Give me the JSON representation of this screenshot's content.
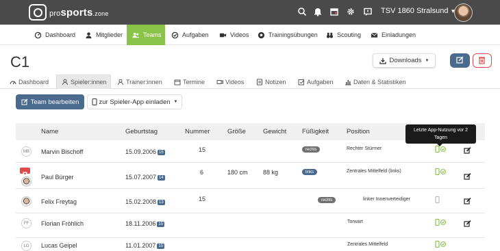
{
  "brand": {
    "logo_text_pro": "pro",
    "logo_text_sports": "sports",
    "logo_text_zone": ".zone"
  },
  "topbar": {
    "club": "TSV 1860 Stralsund"
  },
  "nav": [
    {
      "label": "Dashboard",
      "icon": "dashboard-icon"
    },
    {
      "label": "Mitglieder",
      "icon": "user-icon"
    },
    {
      "label": "Teams",
      "icon": "users-icon",
      "active": true
    },
    {
      "label": "Aufgaben",
      "icon": "check-circle-icon"
    },
    {
      "label": "Videos",
      "icon": "video-icon"
    },
    {
      "label": "Trainingsübungen",
      "icon": "soccer-ball-icon"
    },
    {
      "label": "Scouting",
      "icon": "binoculars-icon"
    },
    {
      "label": "Einladungen",
      "icon": "envelope-icon"
    }
  ],
  "page": {
    "title": "C1",
    "downloads_label": "Downloads"
  },
  "subtabs": [
    {
      "label": "Dashboard"
    },
    {
      "label": "Spieler:innen",
      "active": true
    },
    {
      "label": "Trainer:innen"
    },
    {
      "label": "Termine"
    },
    {
      "label": "Videos"
    },
    {
      "label": "Notizen"
    },
    {
      "label": "Aufgaben"
    },
    {
      "label": "Daten & Statistiken"
    }
  ],
  "actions": {
    "team_edit": "Team bearbeiten",
    "invite": "zur Spieler-App einladen"
  },
  "table": {
    "headers": {
      "name": "Name",
      "birthday": "Geburtstag",
      "number": "Nummer",
      "height": "Größe",
      "weight": "Gewicht",
      "foot": "Füßigkeit",
      "position": "Position"
    },
    "tooltip": "Letzte App-Nutzung vor 2 Tagen",
    "rows": [
      {
        "initials": "MB",
        "name": "Marvin Bischoff",
        "birthday": "15.09.2006",
        "age": "15",
        "number": "15",
        "height": "",
        "weight": "",
        "foot": "rechts",
        "position": "Rechter Stürmer",
        "app": "active"
      },
      {
        "initials": "",
        "name": "Paul Bürger",
        "birthday": "15.07.2007",
        "age": "14",
        "number": "6",
        "height": "180 cm",
        "weight": "88 kg",
        "foot": "links",
        "position": "Zentrales Mittelfeld (links)",
        "app": "active"
      },
      {
        "initials": "",
        "name": "Felix Freytag",
        "birthday": "15.02.2008",
        "age": "13",
        "number": "15",
        "height": "",
        "weight": "",
        "foot": "rechts",
        "position": "linker Innenverteidiger",
        "app": "inactive"
      },
      {
        "initials": "FF",
        "name": "Florian Fröhlich",
        "birthday": "18.11.2006",
        "age": "15",
        "number": "",
        "height": "",
        "weight": "",
        "foot": "",
        "position": "Torwart",
        "app": "active"
      },
      {
        "initials": "LG",
        "name": "Lucas Geipel",
        "birthday": "11.01.2007",
        "age": "15",
        "number": "",
        "height": "",
        "weight": "",
        "foot": "",
        "position": "Zentrales Mittelfeld",
        "app": "active"
      }
    ]
  },
  "colors": {
    "accent_green": "#8bc34a",
    "primary_blue": "#4a6a8e",
    "topbar": "#4a4a4a",
    "danger": "#e04a4a"
  }
}
